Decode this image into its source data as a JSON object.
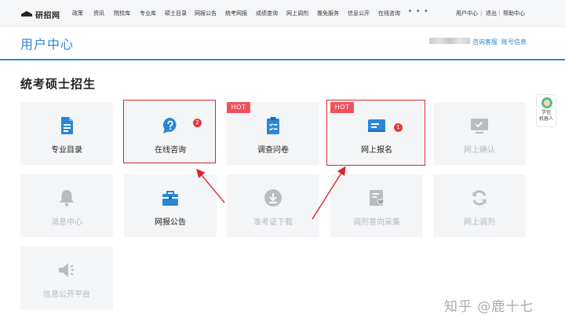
{
  "site": {
    "logo_text": "研招网",
    "nav": [
      "政策",
      "资讯",
      "院校库",
      "专业库",
      "硕士目录",
      "网报公告",
      "统考网报",
      "成绩查询",
      "网上调剂",
      "推免服务",
      "信息公开",
      "在线咨询"
    ],
    "nav_more": "• • •",
    "user_links": [
      "用户中心",
      "退出",
      "帮助中心"
    ],
    "separator": "|"
  },
  "header": {
    "title": "用户中心",
    "links": [
      "咨询客服",
      "账号信息"
    ]
  },
  "section": {
    "title": "统考硕士招生"
  },
  "tiles": [
    {
      "label": "专业目录",
      "icon": "document-icon",
      "state": "active"
    },
    {
      "label": "在线咨询",
      "icon": "chat-question-icon",
      "state": "active",
      "badge": "2"
    },
    {
      "label": "调查问卷",
      "icon": "clipboard-check-icon",
      "state": "active",
      "hot": "HOT"
    },
    {
      "label": "网上报名",
      "icon": "id-card-icon",
      "state": "active",
      "hot": "HOT",
      "badge": "1"
    },
    {
      "label": "网上确认",
      "icon": "monitor-check-icon",
      "state": "disabled"
    },
    {
      "label": "消息中心",
      "icon": "bell-icon",
      "state": "disabled"
    },
    {
      "label": "网报公告",
      "icon": "announcement-bag-icon",
      "state": "active"
    },
    {
      "label": "准考证下载",
      "icon": "download-icon",
      "state": "disabled"
    },
    {
      "label": "调剂意向采集",
      "icon": "form-heart-icon",
      "state": "disabled"
    },
    {
      "label": "网上调剂",
      "icon": "refresh-icon",
      "state": "disabled"
    },
    {
      "label": "信息公开平台",
      "icon": "speaker-icon",
      "state": "disabled"
    }
  ],
  "side_widget": {
    "label_line1": "学信",
    "label_line2": "机器人"
  },
  "watermark": "知乎 @鹿十七",
  "colors": {
    "accent": "#2f86d6",
    "icon_active": "#2a86d6",
    "icon_disabled": "#b9bdc2",
    "hot": "#f0525b",
    "badge": "#e4393c",
    "highlight_box": "#d9262c"
  }
}
